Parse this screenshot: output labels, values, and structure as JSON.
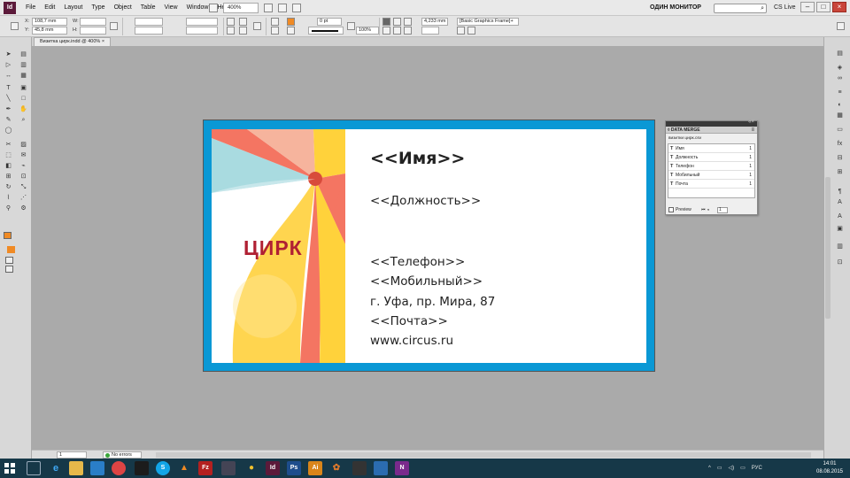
{
  "menubar": {
    "logo": "Id",
    "items": [
      "File",
      "Edit",
      "Layout",
      "Type",
      "Object",
      "Table",
      "View",
      "Window",
      "Help"
    ],
    "zoom": "400%",
    "workspace": "ОДИН МОНИТОР",
    "cs_live": "CS Live"
  },
  "control": {
    "x_label": "X:",
    "x_value": "108,7 mm",
    "y_label": "Y:",
    "y_value": "45,8 mm",
    "w_label": "W:",
    "h_label": "H:",
    "stroke_weight": "0 pt",
    "opacity": "100%",
    "ref_value": "4,233 mm",
    "object_style": "[Basic Graphics Frame]+",
    "fill_color": "#f08a24"
  },
  "document": {
    "tab_title": "Визитка цирк.indd @ 400%"
  },
  "card": {
    "logo": "ЦИРК",
    "name": "<<Имя>>",
    "position": "<<Должность>>",
    "phone": "<<Телефон>>",
    "mobile": "<<Мобильный>>",
    "address": "г. Уфа, пр. Мира, 87",
    "email": "<<Почта>>",
    "website": "www.circus.ru",
    "bleed_color": "#0a98d5",
    "logo_color": "#b02033"
  },
  "data_merge": {
    "title": "◊ DATA MERGE",
    "source": "визитки цирк.csv",
    "fields": [
      {
        "tag": "T",
        "name": "Имя",
        "count": "1"
      },
      {
        "tag": "T",
        "name": "Должность",
        "count": "1"
      },
      {
        "tag": "T",
        "name": "Телефон",
        "count": "1"
      },
      {
        "tag": "T",
        "name": "Мобильный",
        "count": "1"
      },
      {
        "tag": "T",
        "name": "Почта",
        "count": "1"
      }
    ],
    "preview_label": "Preview",
    "record": "1"
  },
  "status": {
    "page": "1",
    "errors": "No errors"
  },
  "taskbar": {
    "language": "РУС",
    "time": "14:01",
    "date": "08.08.2015"
  }
}
